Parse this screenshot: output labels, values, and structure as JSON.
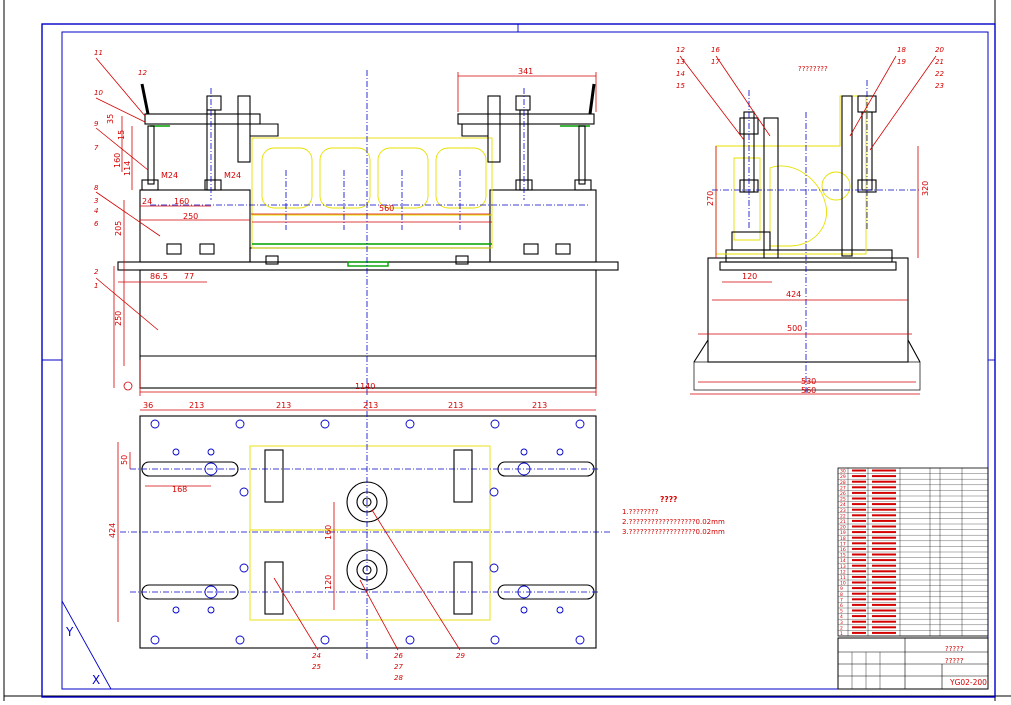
{
  "drawing": {
    "front_view": {
      "dims": [
        "341",
        "35",
        "15",
        "160",
        "114",
        "205",
        "250",
        "M24",
        "M24",
        "160",
        "250",
        "24",
        "560",
        "86.5",
        "77",
        "1140"
      ],
      "part_labels": [
        "11",
        "12",
        "10",
        "9",
        "7",
        "8",
        "3",
        "4",
        "6",
        "2",
        "1"
      ]
    },
    "side_view": {
      "caption": "????????",
      "dims": [
        "270",
        "320",
        "120",
        "424",
        "500",
        "530",
        "560"
      ],
      "part_labels": [
        "12",
        "13",
        "14",
        "15",
        "16",
        "17",
        "18",
        "19",
        "20",
        "21",
        "22",
        "23"
      ]
    },
    "plan_view": {
      "dims": [
        "36",
        "213",
        "213",
        "213",
        "213",
        "213",
        "50",
        "168",
        "424",
        "160",
        "120"
      ],
      "part_labels": [
        "24",
        "25",
        "26",
        "27",
        "28",
        "29"
      ]
    },
    "tech_notes": {
      "title": "????",
      "lines": [
        "1.????????",
        "2.??????????????????0.02mm",
        "3.??????????????????0.02mm"
      ]
    },
    "title_block": {
      "name": "?????",
      "subname": "?????",
      "drawing_no": "YG02-200"
    },
    "bom_rows": [
      "30",
      "29",
      "28",
      "27",
      "26",
      "25",
      "24",
      "23",
      "22",
      "21",
      "20",
      "19",
      "18",
      "17",
      "16",
      "15",
      "14",
      "13",
      "12",
      "11",
      "10",
      "9",
      "8",
      "7",
      "6",
      "5",
      "4",
      "3",
      "2",
      "1"
    ]
  }
}
